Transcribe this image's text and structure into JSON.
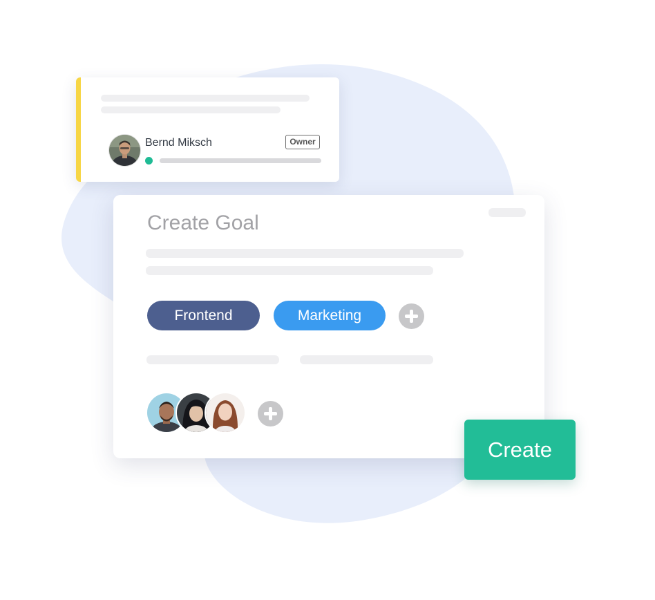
{
  "owner_card": {
    "name": "Bernd Miksch",
    "role_badge": "Owner",
    "status_color": "#1fbb95",
    "accent_color": "#f7d645"
  },
  "dialog": {
    "title": "Create Goal",
    "tags": [
      {
        "label": "Frontend",
        "color": "#4d5f8f"
      },
      {
        "label": "Marketing",
        "color": "#3a9bf0"
      }
    ],
    "add_tag_icon": "plus-icon",
    "add_member_icon": "plus-icon",
    "member_count": 3
  },
  "actions": {
    "create_label": "Create",
    "create_color": "#22bd97"
  },
  "colors": {
    "blob": "#e8eefb",
    "skeleton": "#efeff1"
  }
}
